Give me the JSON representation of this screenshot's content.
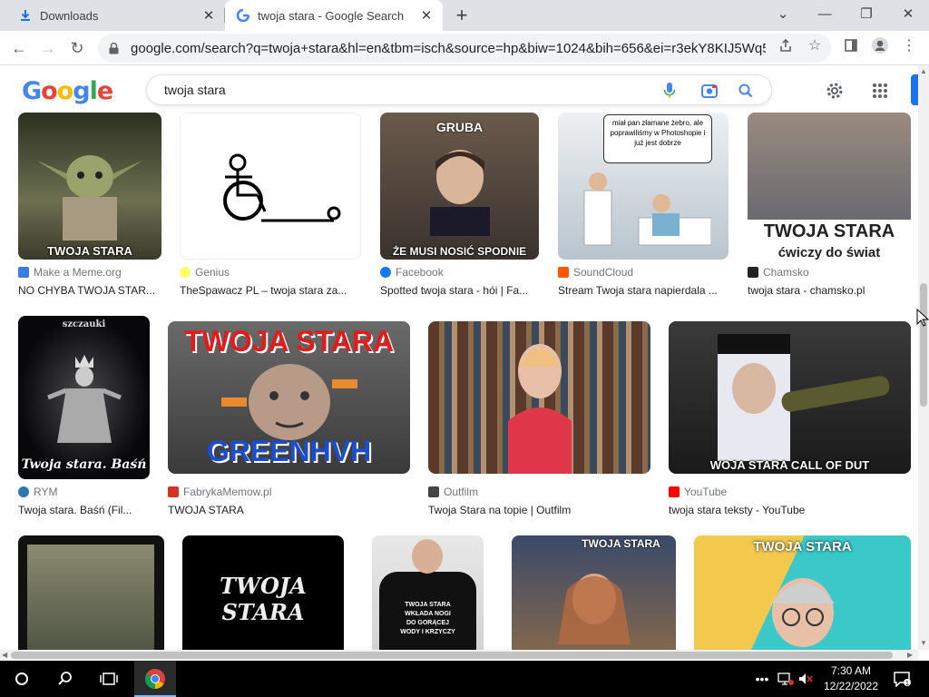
{
  "browser": {
    "tabs": [
      {
        "title": "Downloads",
        "icon": "download-icon"
      },
      {
        "title": "twoja stara - Google Search",
        "icon": "google-g-icon"
      }
    ],
    "url": "google.com/search?q=twoja+stara&hl=en&tbm=isch&source=hp&biw=1024&bih=656&ei=r3ekY8KIJ5Wq5N..."
  },
  "google": {
    "logo": [
      "G",
      "o",
      "o",
      "g",
      "l",
      "e"
    ],
    "logo_colors": [
      "#4285f4",
      "#ea4335",
      "#fbbc05",
      "#4285f4",
      "#34a853",
      "#ea4335"
    ],
    "query": "twoja stara"
  },
  "results": [
    {
      "source": "Make a Meme.org",
      "title": "NO CHYBA TWOJA STAR...",
      "caption": "TWOJA STARA",
      "fav": "#3b7ddd"
    },
    {
      "source": "Genius",
      "title": "TheSpawacz PL – twoja stara za...",
      "caption": "",
      "fav": "#ffff64"
    },
    {
      "source": "Facebook",
      "title": "Spotted twoja stara - hói | Fa...",
      "caption": "ŻE MUSI NOSIĆ SPODNIE",
      "top_caption": "GRUBA",
      "fav": "#1877f2"
    },
    {
      "source": "SoundCloud",
      "title": "Stream Twoja stara napierdala ...",
      "caption": "",
      "top_caption": "miał pan złamane żebro, ale poprawiliśmy w Photoshopie i już jest dobrze",
      "fav": "#ff5500"
    },
    {
      "source": "Chamsko",
      "title": "twoja stara - chamsko.pl",
      "caption": "TWOJA STARA",
      "sub_caption": "ćwiczy do świat",
      "fav": "#222222"
    },
    {
      "source": "RYM",
      "title": "Twoja stara. Baśń (Fil...",
      "caption": "Twoja stara. Baśń",
      "top_caption": "szczauki",
      "fav": "#2a7ab0"
    },
    {
      "source": "FabrykaMemow.pl",
      "title": "TWOJA STARA",
      "caption": "GREENHVH",
      "top_caption": "TWOJA STARA",
      "fav": "#d93025"
    },
    {
      "source": "Outfilm",
      "title": "Twoja Stara na topie | Outfilm",
      "caption": "",
      "fav": "#444444"
    },
    {
      "source": "YouTube",
      "title": "twoja stara teksty - YouTube",
      "caption": "WOJA STARA CALL OF DUT",
      "fav": "#ff0000"
    },
    {
      "source": "",
      "title": "",
      "caption": "",
      "fav": ""
    },
    {
      "source": "",
      "title": "",
      "caption": "TWOJA STARA",
      "fav": ""
    },
    {
      "source": "",
      "title": "",
      "caption": "TWOJA STARA WKŁADA NOGI DO GORĄCEJ WODY I KRZYCZY",
      "fav": ""
    },
    {
      "source": "",
      "title": "",
      "caption": "TWOJA STARA",
      "fav": ""
    },
    {
      "source": "",
      "title": "",
      "caption": "TWOJA STARA",
      "fav": ""
    }
  ],
  "taskbar": {
    "time": "7:30 AM",
    "date": "12/22/2022"
  }
}
